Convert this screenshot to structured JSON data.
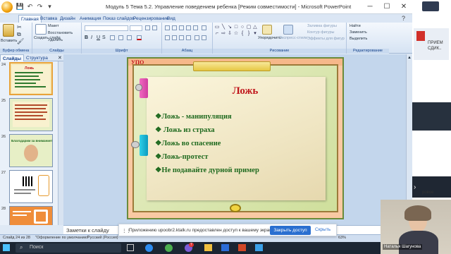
{
  "window": {
    "title": "Модуль 5 Тема 5.2. Управление поведением ребенка [Режим совместимости] - Microsoft PowerPoint"
  },
  "ribbon_tabs": [
    "Главная",
    "Вставка",
    "Дизайн",
    "Анимация",
    "Показ слайдов",
    "Рецензирование",
    "Вид"
  ],
  "ribbon": {
    "clipboard": {
      "paste": "Вставить",
      "cut": "Вырезать",
      "copy": "Копировать",
      "format": "Формат по образцу",
      "label": "Буфер обмена"
    },
    "slides": {
      "new_slide": "Создать слайд",
      "layout": "Макет",
      "reset": "Восстановить",
      "delete": "Удалить",
      "label": "Слайды"
    },
    "font": {
      "label": "Шрифт",
      "bold": "B",
      "italic": "I",
      "underline": "U",
      "strike": "S"
    },
    "paragraph": {
      "label": "Абзац"
    },
    "drawing": {
      "label": "Рисование",
      "arrange": "Упорядочить",
      "quick_styles": "Экспресс-стили",
      "fill": "Заливка фигуры",
      "outline": "Контур фигуры",
      "effects": "Эффекты для фигур"
    },
    "editing": {
      "label": "Редактирование",
      "find": "Найти",
      "replace": "Заменить",
      "select": "Выделить"
    }
  },
  "left_panel": {
    "tabs": [
      "Слайды",
      "Структура"
    ],
    "thumbs": [
      {
        "num": "24",
        "title": "Ложь"
      },
      {
        "num": "25",
        "title": ""
      },
      {
        "num": "26",
        "title": "Благодарим за внимание!"
      },
      {
        "num": "27",
        "title": ""
      },
      {
        "num": "28",
        "title": ""
      }
    ]
  },
  "slide": {
    "header_logo": "УПО",
    "title": "Ложь",
    "bullets": [
      "❖Ложь - манипуляция",
      "❖    Ложь  из страха",
      "❖Ложь во спасение",
      "❖Ложь-протест",
      "❖Не подавайте дурной пример"
    ]
  },
  "notes": {
    "placeholder": "Заметки к слайду"
  },
  "share_bar": {
    "message": "Приложению upoobr2.ktalk.ru предоставлен доступ к вашему экрану.",
    "stop_button": "Закрыть доступ",
    "hide_button": "Скрыть"
  },
  "status_bar": {
    "slide": "Слайд 24 из 28",
    "theme": "\"Оформление по умолчанию\"",
    "language": "Русский (Россия)",
    "zoom": "63%"
  },
  "taskbar": {
    "search_placeholder": "Поиск",
    "badge": "7"
  },
  "right_strip": {
    "text1": "ПРИЕМ",
    "text2": "СДИК..",
    "text3": "ровое"
  },
  "webcam": {
    "name": "Наталья Шагунова"
  },
  "colors": {
    "accent": "#2a6fd0",
    "slide_title": "#c0161c",
    "bullets": "#1f6a1f"
  }
}
